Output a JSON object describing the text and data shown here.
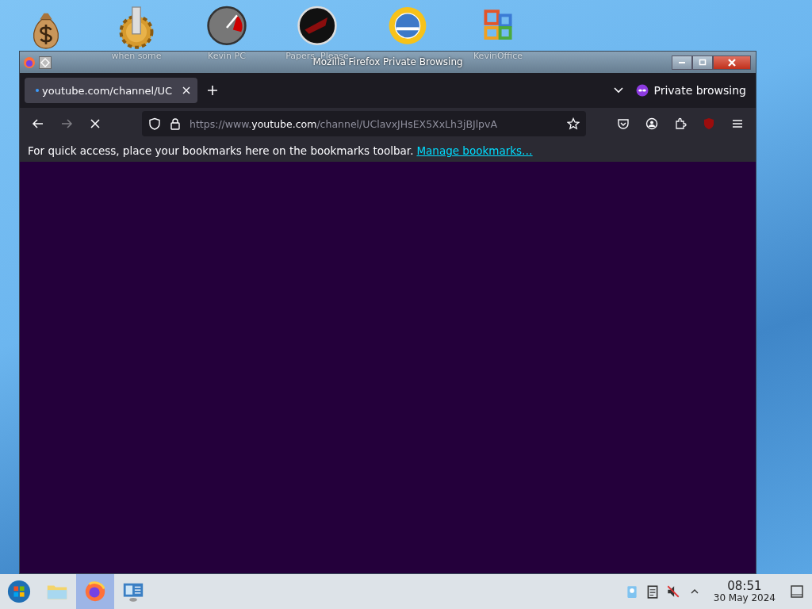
{
  "desktop_icons": [
    {
      "kind": "moneybag"
    },
    {
      "kind": "gear",
      "label": "when some"
    },
    {
      "kind": "gauge",
      "label": "Kevin PC"
    },
    {
      "kind": "darkdisc",
      "label": "Papers, Please"
    },
    {
      "kind": "globe"
    },
    {
      "kind": "office",
      "label": "KevinOffice"
    }
  ],
  "window": {
    "title": "Mozilla Firefox Private Browsing"
  },
  "tabs": [
    {
      "label": "youtube.com/channel/UC",
      "selected": true,
      "loading": true
    }
  ],
  "private_label": "Private browsing",
  "address": {
    "prefix": "https://www.",
    "host": "youtube.com",
    "path": "/channel/UClavxJHsEX5XxLh3jBJlpvA"
  },
  "loading": true,
  "bookmarks_bar": {
    "message": "For quick access, place your bookmarks here on the bookmarks toolbar.",
    "link": "Manage bookmarks…"
  },
  "taskbar": {
    "apps": [
      {
        "kind": "folder",
        "selected": false
      },
      {
        "kind": "firefox",
        "selected": true
      },
      {
        "kind": "monitor",
        "selected": false
      }
    ],
    "time": "08:51",
    "date": "30 May 2024",
    "muted": true
  }
}
